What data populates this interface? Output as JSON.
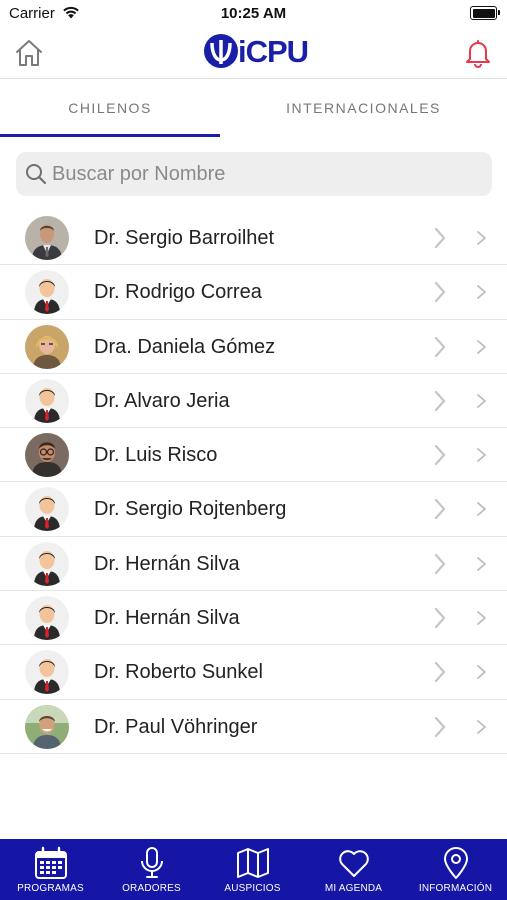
{
  "status_bar": {
    "carrier": "Carrier",
    "time": "10:25 AM"
  },
  "header": {
    "logo_text": "iCPU",
    "home_icon": "home-icon",
    "bell_icon": "bell-icon"
  },
  "tabs": [
    {
      "label": "CHILENOS",
      "active": true
    },
    {
      "label": "INTERNACIONALES",
      "active": false
    }
  ],
  "search": {
    "placeholder": "Buscar por Nombre",
    "value": ""
  },
  "speakers": [
    {
      "name": "Dr. Sergio Barroilhet",
      "avatar": "photo-man-suit"
    },
    {
      "name": "Dr. Rodrigo Correa",
      "avatar": "placeholder-man"
    },
    {
      "name": "Dra. Daniela Gómez",
      "avatar": "photo-woman"
    },
    {
      "name": "Dr. Alvaro Jeria",
      "avatar": "placeholder-man"
    },
    {
      "name": "Dr. Luis Risco",
      "avatar": "photo-man-glasses"
    },
    {
      "name": "Dr. Sergio Rojtenberg",
      "avatar": "placeholder-man"
    },
    {
      "name": "Dr. Hernán Silva",
      "avatar": "placeholder-man"
    },
    {
      "name": "Dr. Hernán Silva",
      "avatar": "placeholder-man"
    },
    {
      "name": "Dr. Roberto Sunkel",
      "avatar": "placeholder-man"
    },
    {
      "name": "Dr. Paul Vöhringer",
      "avatar": "photo-man-outdoor"
    }
  ],
  "tab_bar": [
    {
      "label": "PROGRAMAS",
      "icon": "calendar-icon"
    },
    {
      "label": "ORADORES",
      "icon": "microphone-icon"
    },
    {
      "label": "AUSPICIOS",
      "icon": "map-icon"
    },
    {
      "label": "MI AGENDA",
      "icon": "heart-icon"
    },
    {
      "label": "INFORMACIÓN",
      "icon": "location-pin-icon"
    }
  ],
  "colors": {
    "brand": "#1a1fa8",
    "tab_bar_bg": "#1515a6",
    "bell": "#e8364d",
    "tie": "#d8232a"
  }
}
